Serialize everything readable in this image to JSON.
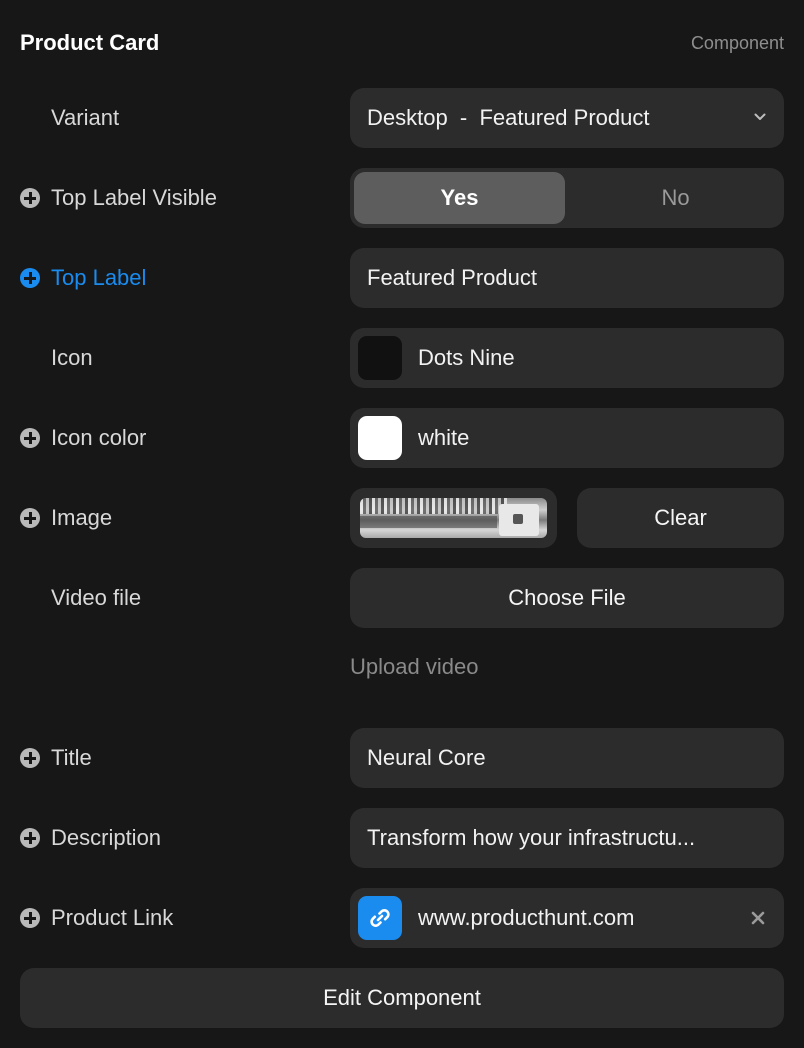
{
  "header": {
    "title": "Product Card",
    "subtitle": "Component"
  },
  "fields": {
    "variant": {
      "label": "Variant",
      "value": "Desktop  -  Featured Product"
    },
    "top_label_visible": {
      "label": "Top Label Visible",
      "options": [
        "Yes",
        "No"
      ],
      "selected": "Yes"
    },
    "top_label": {
      "label": "Top Label",
      "value": "Featured Product"
    },
    "icon": {
      "label": "Icon",
      "value": "Dots Nine",
      "swatch_color": "#111111"
    },
    "icon_color": {
      "label": "Icon color",
      "value": "white",
      "swatch_color": "#ffffff"
    },
    "image": {
      "label": "Image",
      "clear_label": "Clear"
    },
    "video_file": {
      "label": "Video file",
      "button_label": "Choose File",
      "hint": "Upload video"
    },
    "title": {
      "label": "Title",
      "value": "Neural Core"
    },
    "description": {
      "label": "Description",
      "value": "Transform how your infrastructu..."
    },
    "product_link": {
      "label": "Product Link",
      "value": "www.producthunt.com"
    }
  },
  "footer": {
    "edit_label": "Edit Component"
  },
  "colors": {
    "accent": "#1a8cf0",
    "background": "#171717",
    "control": "#2c2c2c"
  }
}
